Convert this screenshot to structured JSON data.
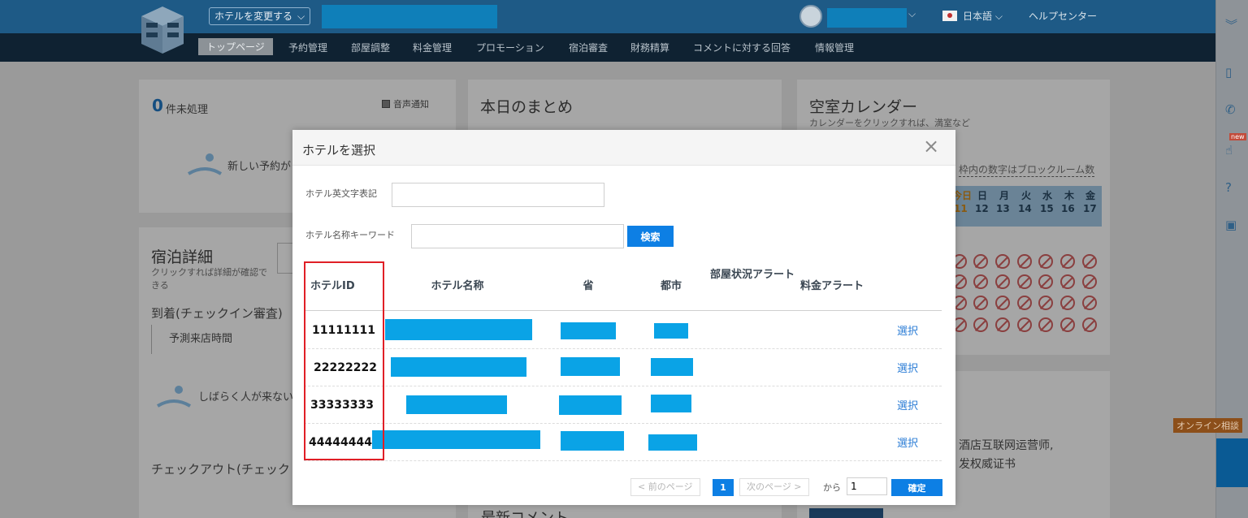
{
  "header": {
    "change_hotel": "ホテルを変更する",
    "language": "日本語",
    "help": "ヘルプセンター"
  },
  "nav": {
    "items": [
      "トップページ",
      "予約管理",
      "部屋調整",
      "料金管理",
      "プロモーション",
      "宿泊審査",
      "財務精算",
      "コメントに対する回答",
      "情報管理"
    ]
  },
  "background": {
    "pending_count": "0",
    "pending_label": "件未処理",
    "sound_notice": "音声通知",
    "new_reservation": "新しい予約が",
    "summary_title": "本日のまとめ",
    "calendar_title": "空室カレンダー",
    "calendar_sub": "カレンダーをクリックすれば、満室など",
    "calendar_note": "枠内の数字はブロックルーム数",
    "calendar_days": [
      "今日",
      "日",
      "月",
      "火",
      "水",
      "木",
      "金"
    ],
    "calendar_dates": [
      "11",
      "12",
      "13",
      "14",
      "15",
      "16",
      "17"
    ],
    "stay_title": "宿泊詳細",
    "stay_sub": "クリックすれば詳細が確認できる",
    "checkin": "到着(チェックイン審査)",
    "eta": "予測来店時間",
    "nobody_coming": "しばらく人が来ない",
    "checkout": "チェックアウト(チェック",
    "latest_comments": "最新コメント",
    "cn_text_1": "酒店互联网运营师,",
    "cn_text_2": "发权威证书",
    "online_consult": "オンライン相談",
    "new_badge": "new"
  },
  "modal": {
    "title": "ホテルを選択",
    "close_icon": "×",
    "english_name_label": "ホテル英文字表記",
    "keyword_label": "ホテル名称キーワード",
    "search_button": "検索",
    "columns": [
      "ホテルID",
      "ホテル名称",
      "省",
      "都市",
      "部屋状況アラート",
      "料金アラート"
    ],
    "rows": [
      {
        "id": "11111111",
        "action": "選択"
      },
      {
        "id": "22222222",
        "action": "選択"
      },
      {
        "id": "33333333",
        "action": "選択"
      },
      {
        "id": "44444444",
        "action": "選択"
      }
    ],
    "pager": {
      "prev": "< 前のページ",
      "current": "1",
      "next": "次のページ >",
      "from": "から",
      "page_input": "1",
      "confirm": "確定"
    }
  },
  "colors": {
    "accent": "#0d7fe4",
    "highlight_box": "#e01f26",
    "redaction": "#0aa3e6",
    "link": "#2d7ed6"
  }
}
